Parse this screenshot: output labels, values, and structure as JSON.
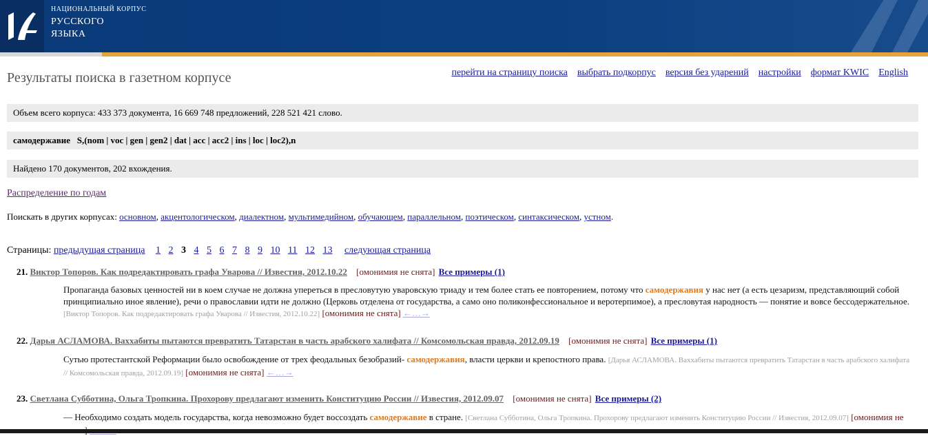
{
  "banner": {
    "line1": "НАЦИОНАЛЬНЫЙ КОРПУС",
    "line2": "РУССКОГО",
    "line3": "ЯЗЫКА"
  },
  "page_title": "Результаты поиска в газетном корпусе",
  "topnav": [
    "перейти на страницу поиска",
    "выбрать подкорпус",
    "версия без ударений",
    "настройки",
    "формат KWIC",
    "English"
  ],
  "corpus_size": "Объем всего корпуса: 433 373 документа, 16 669 748 предложений, 228 521 421 слово.",
  "query": {
    "word": "самодержавие",
    "grammar": "S,(nom | voc | gen | gen2 | dat | acc | acc2 | ins | loc | loc2),n"
  },
  "found": "Найдено 170 документов, 202 вхождения.",
  "years_link": "Распределение по годам",
  "other_corpora": {
    "label": "Поискать в других корпусах:",
    "items": [
      "основном",
      "акцентологическом",
      "диалектном",
      "мультимедийном",
      "обучающем",
      "параллельном",
      "поэтическом",
      "синтаксическом",
      "устном"
    ]
  },
  "pager": {
    "label": "Страницы:",
    "prev": "предыдущая страница",
    "pages": [
      "1",
      "2",
      "3",
      "4",
      "5",
      "6",
      "7",
      "8",
      "9",
      "10",
      "11",
      "12",
      "13"
    ],
    "current": "3",
    "next": "следующая страница"
  },
  "results": [
    {
      "num": "21.",
      "title": "Виктор Топоров. Как подредактировать графа Уварова // Известия, 2012.10.22",
      "omonimia": "[омонимия не снята]",
      "all": "Все примеры (1)",
      "pre": "Пропаганда базовых ценностей ни в коем случае не должна упереться в пресловутую уваровскую триаду и тем более стать ее повторением, потому что ",
      "hit": "самодержавия",
      "post": " у нас нет (а есть цезаризм, представляющий собой принципиально иное явление), речи о православии идти не должно (Церковь отделена от государства, а само оно поликонфессиональное и веротерпимое), а пресловутая народность — понятие и вовсе бессодержательное. ",
      "src": "[Виктор Топоров. Как подредактировать графа Уварова // Известия, 2012.10.22]",
      "arrows": "←…→"
    },
    {
      "num": "22.",
      "title": "Дарья АСЛАМОВА. Ваххабиты пытаются превратить Татарстан в часть арабского халифата // Комсомольская правда, 2012.09.19",
      "omonimia": "[омонимия не снята]",
      "all": "Все примеры (1)",
      "pre": "Сутью протестантской Реформации было освобождение от трех феодальных безобразий- ",
      "hit": "самодержавия",
      "post": ", власти церкви и крепостного права. ",
      "src": "[Дарья АСЛАМОВА. Ваххабиты пытаются превратить Татарстан в часть арабского халифата // Комсомольская правда, 2012.09.19]",
      "arrows": "←…→"
    },
    {
      "num": "23.",
      "title": "Светлана Субботина, Ольга Тропкина. Прохорову предлагают изменить Конституцию России // Известия, 2012.09.07",
      "omonimia": "[омонимия не снята]",
      "all": "Все примеры (2)",
      "pre": "— Необходимо создать модель государства, когда невозможно будет воссоздать ",
      "hit": "самодержавие",
      "post": " в стране. ",
      "src": "[Светлана Субботина, Ольга Тропкина. Прохорову предлагают изменить Конституцию России // Известия, 2012.09.07]",
      "arrows": "←…→"
    }
  ]
}
